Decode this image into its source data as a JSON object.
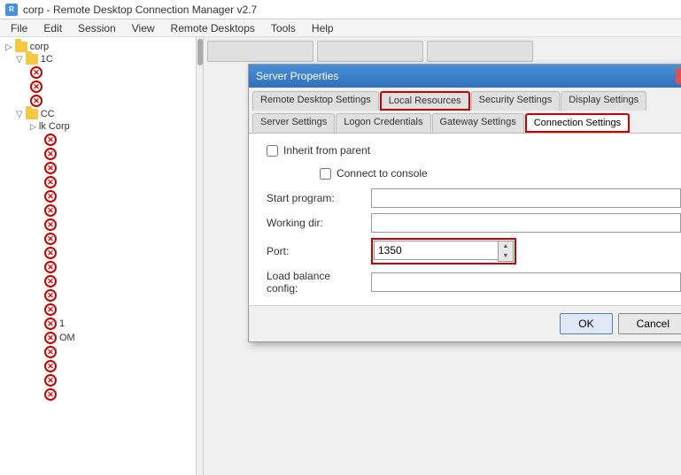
{
  "titleBar": {
    "icon": "RD",
    "text": "corp - Remote Desktop Connection Manager v2.7"
  },
  "menuBar": {
    "items": [
      "File",
      "Edit",
      "Session",
      "View",
      "Remote Desktops",
      "Tools",
      "Help"
    ]
  },
  "sidebar": {
    "nodes": [
      {
        "id": "corp",
        "label": "corp",
        "type": "root",
        "indent": 0
      },
      {
        "id": "1c",
        "label": "1C",
        "type": "folder",
        "indent": 1
      },
      {
        "id": "node1",
        "label": "",
        "type": "error",
        "indent": 2
      },
      {
        "id": "node2",
        "label": "",
        "type": "error",
        "indent": 2
      },
      {
        "id": "node3",
        "label": "",
        "type": "error",
        "indent": 2
      },
      {
        "id": "cc",
        "label": "CC",
        "type": "folder",
        "indent": 1
      },
      {
        "id": "lkcorp",
        "label": "lk Corp",
        "type": "label",
        "indent": 2
      },
      {
        "id": "e1",
        "label": "",
        "type": "error",
        "indent": 3
      },
      {
        "id": "e2",
        "label": "",
        "type": "error",
        "indent": 3
      },
      {
        "id": "e3",
        "label": "",
        "type": "error",
        "indent": 3
      },
      {
        "id": "e4",
        "label": "",
        "type": "error",
        "indent": 3
      },
      {
        "id": "e5",
        "label": "",
        "type": "error",
        "indent": 3
      },
      {
        "id": "e6",
        "label": "",
        "type": "error",
        "indent": 3
      },
      {
        "id": "e7",
        "label": "",
        "type": "error",
        "indent": 3
      },
      {
        "id": "e8",
        "label": "",
        "type": "error",
        "indent": 3
      },
      {
        "id": "e9",
        "label": "",
        "type": "error",
        "indent": 3
      },
      {
        "id": "e10",
        "label": "",
        "type": "error",
        "indent": 3
      },
      {
        "id": "e11",
        "label": "",
        "type": "error",
        "indent": 3
      },
      {
        "id": "e12",
        "label": "",
        "type": "error",
        "indent": 3
      },
      {
        "id": "e13",
        "label": "",
        "type": "error",
        "indent": 3
      },
      {
        "id": "e14",
        "label": "1",
        "type": "error-label",
        "indent": 3
      },
      {
        "id": "e15",
        "label": "OM",
        "type": "error-label",
        "indent": 3
      },
      {
        "id": "e16",
        "label": "",
        "type": "error",
        "indent": 3
      },
      {
        "id": "e17",
        "label": "",
        "type": "error",
        "indent": 3
      },
      {
        "id": "e18",
        "label": "",
        "type": "error",
        "indent": 3
      },
      {
        "id": "e19",
        "label": "",
        "type": "error",
        "indent": 3
      },
      {
        "id": "e20",
        "label": "",
        "type": "error",
        "indent": 3
      }
    ]
  },
  "dialog": {
    "title": "Server Properties",
    "tabs": [
      {
        "id": "rdp-settings",
        "label": "Remote Desktop Settings",
        "active": false
      },
      {
        "id": "local-resources",
        "label": "Local Resources",
        "active": false,
        "highlighted": true
      },
      {
        "id": "security-settings",
        "label": "Security Settings",
        "active": false
      },
      {
        "id": "display-settings",
        "label": "Display Settings",
        "active": false
      },
      {
        "id": "server-settings",
        "label": "Server Settings",
        "active": false
      },
      {
        "id": "logon-credentials",
        "label": "Logon Credentials",
        "active": false
      },
      {
        "id": "gateway-settings",
        "label": "Gateway Settings",
        "active": false
      },
      {
        "id": "connection-settings",
        "label": "Connection Settings",
        "active": true,
        "highlighted": true
      }
    ],
    "body": {
      "inheritCheckbox": {
        "label": "Inherit from parent",
        "checked": false
      },
      "connectConsoleCheckbox": {
        "label": "Connect to console",
        "checked": false
      },
      "fields": [
        {
          "id": "start-program",
          "label": "Start program:",
          "value": "",
          "type": "text"
        },
        {
          "id": "working-dir",
          "label": "Working dir:",
          "value": "",
          "type": "text"
        },
        {
          "id": "port",
          "label": "Port:",
          "value": "1350",
          "type": "port"
        },
        {
          "id": "load-balance",
          "label": "Load balance config:",
          "value": "",
          "type": "text"
        }
      ]
    },
    "footer": {
      "okLabel": "OK",
      "cancelLabel": "Cancel"
    }
  }
}
